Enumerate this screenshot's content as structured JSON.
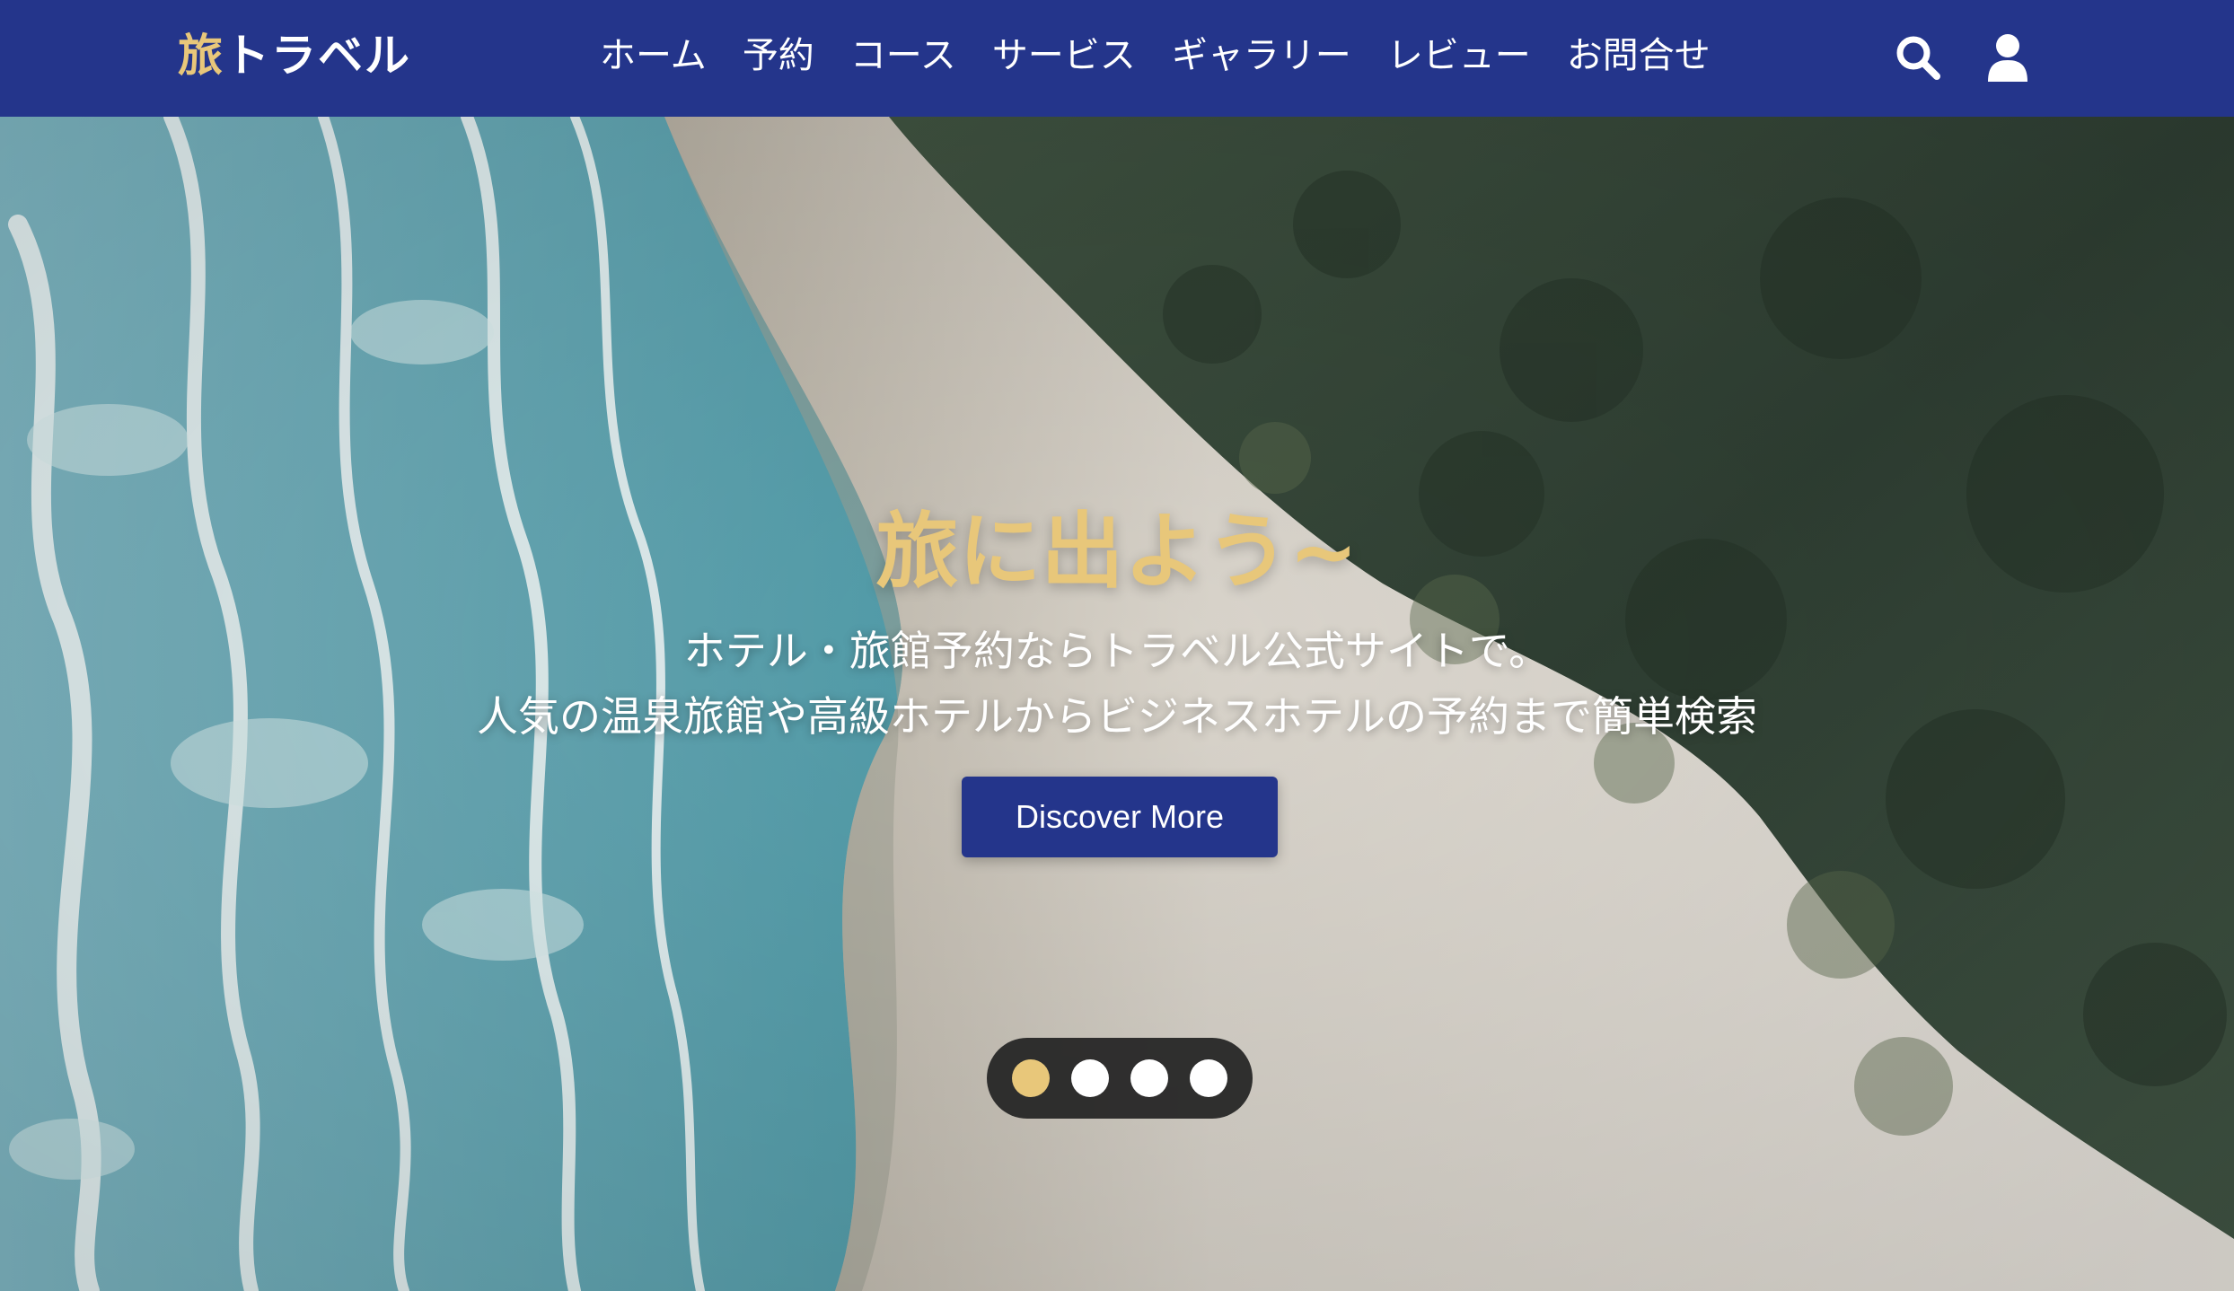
{
  "brand": {
    "logo_accent": "旅",
    "logo_rest": "トラベル",
    "accent_color": "#e8c77a",
    "nav_bg": "#24358b"
  },
  "nav": {
    "items": [
      {
        "label": "ホーム"
      },
      {
        "label": "予約"
      },
      {
        "label": "コース"
      },
      {
        "label": "サービス"
      },
      {
        "label": "ギャラリー"
      },
      {
        "label": "レビュー"
      },
      {
        "label": "お問合せ"
      }
    ],
    "icons": [
      "search-icon",
      "user-icon"
    ]
  },
  "hero": {
    "title": "旅に出よう~",
    "subtitle_line1": "ホテル・旅館予約ならトラベル公式サイトで。",
    "subtitle_line2": "人気の温泉旅館や高級ホテルからビジネスホテルの予約まで簡単検索",
    "cta_label": "Discover More",
    "background": "aerial beach photo"
  },
  "carousel": {
    "slide_count": 4,
    "active_index": 0
  }
}
